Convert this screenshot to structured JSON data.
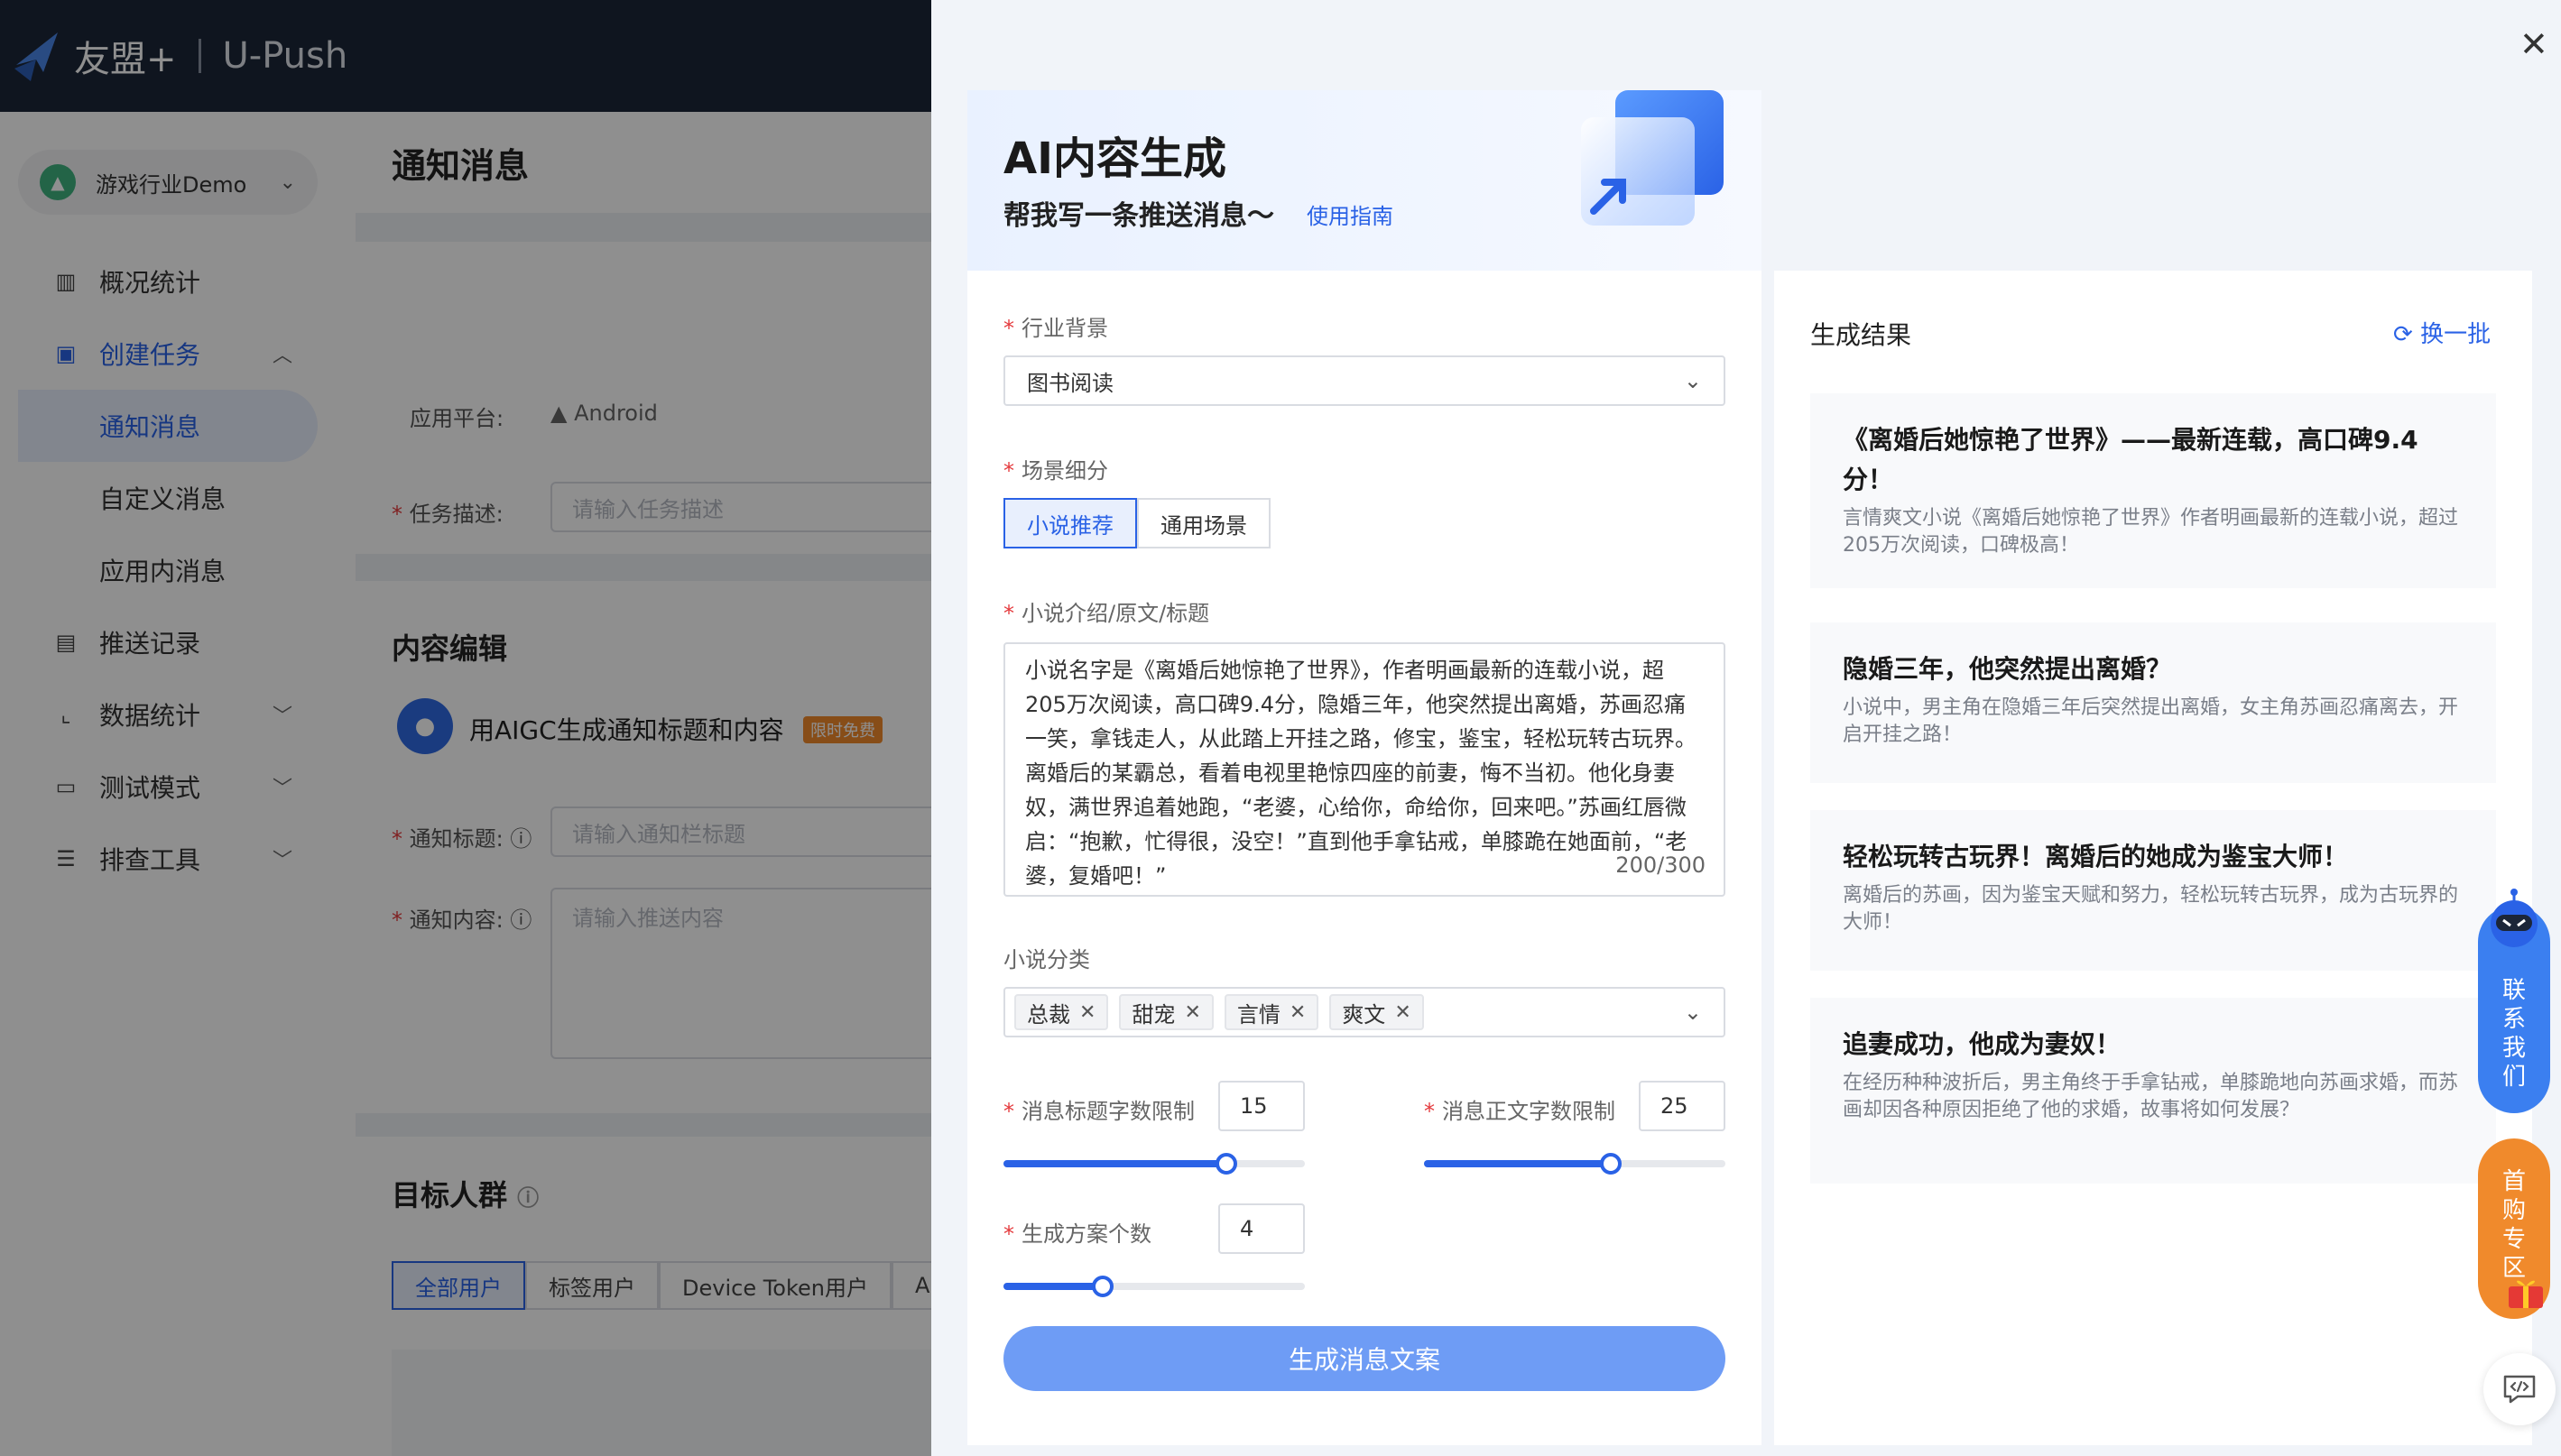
{
  "header": {
    "logo_text": "友盟+",
    "product": "U-Push"
  },
  "sidebar": {
    "app_name": "游戏行业Demo",
    "items": [
      {
        "label": "概况统计",
        "icon": "bar-chart-icon"
      },
      {
        "label": "创建任务",
        "icon": "task-icon"
      },
      {
        "label": "通知消息"
      },
      {
        "label": "自定义消息"
      },
      {
        "label": "应用内消息"
      },
      {
        "label": "推送记录",
        "icon": "record-icon"
      },
      {
        "label": "数据统计",
        "icon": "line-chart-icon"
      },
      {
        "label": "测试模式",
        "icon": "monitor-icon"
      },
      {
        "label": "排查工具",
        "icon": "list-icon"
      }
    ]
  },
  "page": {
    "title": "通知消息",
    "platform_label": "应用平台:",
    "platform_value": "Android",
    "task_desc_label": "任务描述:",
    "task_desc_placeholder": "请输入任务描述",
    "content_section": "内容编辑",
    "aigc_title": "用AIGC生成通知标题和内容",
    "aigc_badge": "限时免费",
    "notice_title_label": "通知标题:",
    "notice_title_placeholder": "请输入通知栏标题",
    "notice_content_label": "通知内容:",
    "notice_content_placeholder": "请输入推送内容",
    "target_section": "目标人群",
    "target_tabs": [
      "全部用户",
      "标签用户",
      "Device Token用户",
      "Ali"
    ]
  },
  "drawer": {
    "title": "AI内容生成",
    "subtitle": "帮我写一条推送消息～",
    "guide_link": "使用指南",
    "industry_label": "行业背景",
    "industry_value": "图书阅读",
    "scene_label": "场景细分",
    "scene_options": [
      "小说推荐",
      "通用场景"
    ],
    "intro_label": "小说介绍/原文/标题",
    "intro_text": "小说名字是《离婚后她惊艳了世界》，作者明画最新的连载小说，超205万次阅读，高口碑9.4分，隐婚三年，他突然提出离婚，苏画忍痛一笑，拿钱走人，从此踏上开挂之路，修宝，鉴宝，轻松玩转古玩界。离婚后的某霸总，看着电视里艳惊四座的前妻，悔不当初。他化身妻奴，满世界追着她跑，“老婆，心给你，命给你，回来吧。”苏画红唇微启：“抱歉，忙得很，没空！”直到他手拿钻戒，单膝跪在她面前，“老婆，复婚吧！”",
    "intro_count": "200/300",
    "category_label": "小说分类",
    "category_tags": [
      "总裁",
      "甜宠",
      "言情",
      "爽文"
    ],
    "title_limit_label": "消息标题字数限制",
    "title_limit_value": "15",
    "title_limit_fraction": 0.74,
    "body_limit_label": "消息正文字数限制",
    "body_limit_value": "25",
    "body_limit_fraction": 0.62,
    "plan_count_label": "生成方案个数",
    "plan_count_value": "4",
    "plan_count_fraction": 0.33,
    "generate_button": "生成消息文案",
    "results_title": "生成结果",
    "refresh_label": "换一批",
    "results": [
      {
        "title": "《离婚后她惊艳了世界》——最新连载，高口碑9.4分！",
        "desc": "言情爽文小说《离婚后她惊艳了世界》作者明画最新的连载小说，超过205万次阅读，口碑极高！"
      },
      {
        "title": "隐婚三年，他突然提出离婚？",
        "desc": "小说中，男主角在隐婚三年后突然提出离婚，女主角苏画忍痛离去，开启开挂之路！"
      },
      {
        "title": "轻松玩转古玩界！离婚后的她成为鉴宝大师！",
        "desc": "离婚后的苏画，因为鉴宝天赋和努力，轻松玩转古玩界，成为古玩界的大师！"
      },
      {
        "title": "追妻成功，他成为妻奴！",
        "desc": "在经历种种波折后，男主角终于手拿钻戒，单膝跪地向苏画求婚，而苏画却因各种原因拒绝了他的求婚，故事将如何发展？"
      }
    ]
  },
  "floating": {
    "contact": [
      "联",
      "系",
      "我",
      "们"
    ],
    "first_buy": [
      "首",
      "购",
      "专",
      "区"
    ]
  },
  "colors": {
    "accent": "#2a62e6",
    "topbar": "#1c2638",
    "required": "#e4393c",
    "contact": "#3b7ff0",
    "first_buy": "#f08a2c"
  }
}
